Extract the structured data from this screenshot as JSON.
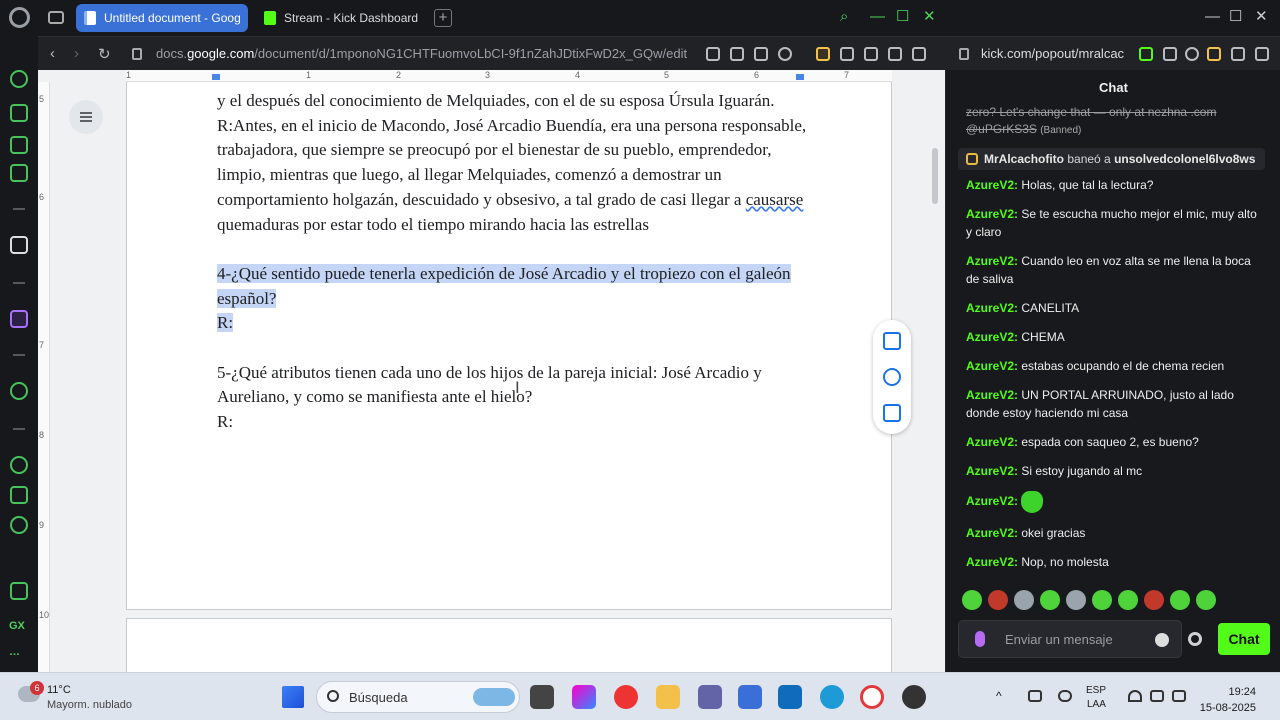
{
  "browser": {
    "tabs": [
      {
        "label": "Untitled document - Goog",
        "active": true
      },
      {
        "label": "Stream - Kick Dashboard",
        "active": false
      }
    ],
    "new_tab": "+",
    "window_controls": {
      "search": "⌕",
      "minimize": "—",
      "maximize": "☐",
      "close": "✕"
    },
    "url_prefix": "docs.",
    "url_domain": "google.com",
    "url_rest": "/document/d/1mponoNG1CHTFuomvoLbCI-9f1nZahJDtixFwD2x_GQw/edit",
    "nav": {
      "back": "‹",
      "forward": "›",
      "reload": "↻"
    }
  },
  "sidebar": {
    "gx_label": "GX",
    "more_label": "…"
  },
  "ruler": {
    "ticks": [
      "1",
      "1",
      "2",
      "3",
      "4",
      "5",
      "6",
      "7"
    ],
    "vticks": [
      "5",
      "6",
      "7",
      "8",
      "9",
      "10"
    ]
  },
  "document": {
    "p1": "y el después del conocimiento de Melquiades, con el de su esposa Úrsula Iguarán.",
    "p2_before": "R:Antes, en el inicio de Macondo, José Arcadio Buendía, era una persona responsable, trabajadora, que siempre se preocupó por el bienestar de su pueblo, emprendedor, limpio, mientras que luego, al llegar Melquiades, comenzó a demostrar un comportamiento holgazán, descuidado y obsesivo, a tal grado de casi llegar a ",
    "p2_squig": "causarse",
    "p2_after": " quemaduras por estar todo el tiempo mirando hacia las estrellas",
    "q4": "4-¿Qué sentido puede tenerla expedición de José Arcadio y el tropiezo con el galeón español?",
    "r4": "R:",
    "q5": "5-¿Qué atributos tienen cada uno de los hijos de la pareja inicial: José Arcadio y Aureliano, y como se manifiesta ante el hielo?",
    "r5": "R:"
  },
  "kick": {
    "url": "kick.com/popout/mralcac",
    "chat_title": "Chat",
    "banned_text": "zero? Let's change that — only at nezhna .com @uPGrKS3S",
    "banned_tag": "(Banned)",
    "ban_note": {
      "moderator": "MrAlcachofito",
      "action": " baneó a ",
      "target": "unsolvedcolonel6lvo8ws"
    },
    "messages": [
      {
        "user": "AzureV2:",
        "text": "Holas, que tal la lectura?"
      },
      {
        "user": "AzureV2:",
        "text": "Se te escucha mucho mejor el mic, muy alto y claro"
      },
      {
        "user": "AzureV2:",
        "text": "Cuando leo en voz alta se me llena la boca de saliva"
      },
      {
        "user": "AzureV2:",
        "text": "CANELITA"
      },
      {
        "user": "AzureV2:",
        "text": "CHEMA"
      },
      {
        "user": "AzureV2:",
        "text": "estabas ocupando el de chema recien"
      },
      {
        "user": "AzureV2:",
        "text": "UN PORTAL ARRUINADO, justo al lado donde estoy haciendo mi casa"
      },
      {
        "user": "AzureV2:",
        "text": "espada con saqueo 2, es bueno?"
      },
      {
        "user": "AzureV2:",
        "text": "Si estoy jugando al mc"
      },
      {
        "user": "AzureV2:",
        "text": "",
        "emote": "green-frog-emote"
      },
      {
        "user": "AzureV2:",
        "text": "okei gracias"
      },
      {
        "user": "AzureV2:",
        "text": "Nop, no molesta"
      }
    ],
    "input_placeholder": "Enviar un mensaje",
    "send_label": "Chat"
  },
  "taskbar": {
    "weather_badge": "6",
    "temp": "11°C",
    "condition": "Mayorm. nublado",
    "search_label": "Búsqueda",
    "lang_top": "ESP",
    "lang_bottom": "LAA",
    "time": "19:24",
    "date": "15-08-2025"
  },
  "colors": {
    "kick_green": "#53fc18",
    "docs_highlight": "#c4d5f5",
    "tab_blue": "#3a71d6"
  }
}
